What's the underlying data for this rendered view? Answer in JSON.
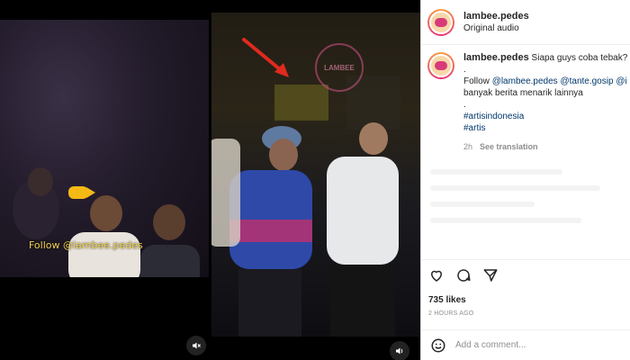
{
  "post": {
    "username": "lambee.pedes",
    "audio": "Original audio",
    "caption": {
      "line1": "Siapa guys coba tebak?",
      "line2": ".",
      "follow_prefix": "Follow ",
      "mention1": "@lambee.pedes",
      "mention2": "@tante.gosip",
      "mention3": "@i",
      "line4": "banyak berita menarik lainnya",
      "line5": ".",
      "hashtag1": "#artisindonesia",
      "hashtag2": "#artis"
    },
    "time": "2h",
    "see_translation": "See translation",
    "likes": "735 likes",
    "time_ago": "2 HOURS AGO",
    "comment_placeholder": "Add a comment..."
  },
  "video": {
    "overlay_follow": "Follow @lambee.pedes"
  },
  "icons": {
    "mute_left": "muted-speaker-icon",
    "mute_right": "speaker-icon",
    "like": "heart-icon",
    "comment": "comment-icon",
    "share": "paper-plane-icon",
    "emoji": "emoji-icon"
  },
  "colors": {
    "link": "#00376b",
    "overlay_text": "#f3d24a",
    "avatar_ring": "#e6337a"
  }
}
